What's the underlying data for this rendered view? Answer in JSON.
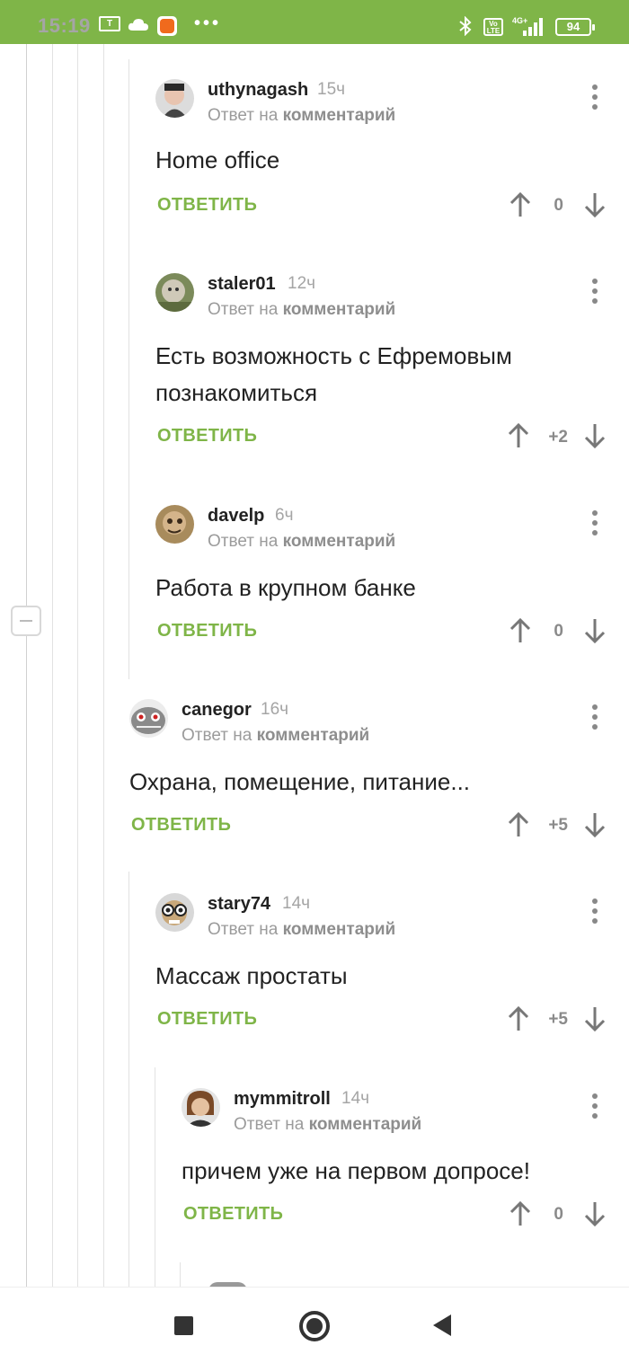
{
  "status_bar": {
    "time": "15:19",
    "battery": "94",
    "network": "4G+",
    "volte": "Vo LTE",
    "sim_badge": "T",
    "more_dots": "•••"
  },
  "labels": {
    "reply_to_prefix": "Ответ на",
    "reply_to_target": "комментарий",
    "reply_button": "ОТВЕТИТЬ"
  },
  "comments": [
    {
      "username": "uthynagash",
      "time": "15ч",
      "text": [
        "Home office"
      ],
      "score": "0"
    },
    {
      "username": "staler01",
      "time": "12ч",
      "text": [
        "Есть возможность с Ефремовым",
        "познакомиться"
      ],
      "score": "+2"
    },
    {
      "username": "davelp",
      "time": "6ч",
      "text": [
        "Работа в крупном банке"
      ],
      "score": "0"
    },
    {
      "username": "canegor",
      "time": "16ч",
      "text": [
        "Охрана, помещение, питание..."
      ],
      "score": "+5"
    },
    {
      "username": "stary74",
      "time": "14ч",
      "text": [
        "Массаж простаты"
      ],
      "score": "+5"
    },
    {
      "username": "mymmitroll",
      "time": "14ч",
      "text": [
        "причем уже на первом допросе!"
      ],
      "score": "0"
    }
  ],
  "colors": {
    "accent": "#7fb548",
    "username": "#222222",
    "muted": "#9b9b9b",
    "score": "#8a8a8a",
    "vote_arrow": "#777777"
  },
  "icons": {
    "status": [
      "sim-icon",
      "cloud-icon",
      "mi-app-icon",
      "bluetooth-icon",
      "volte-icon",
      "signal-icon",
      "battery-icon"
    ],
    "comment": [
      "avatar",
      "more-vertical-icon",
      "arrow-up-icon",
      "arrow-down-icon"
    ],
    "nav": [
      "recents-square-icon",
      "home-circle-icon",
      "back-triangle-icon"
    ],
    "thread": [
      "collapse-minus-icon"
    ]
  }
}
